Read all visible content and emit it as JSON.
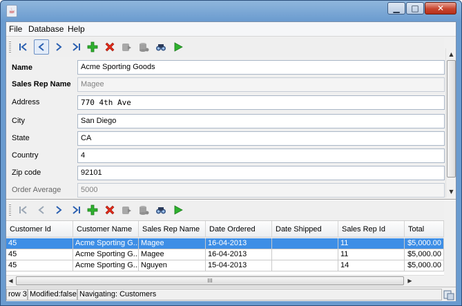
{
  "window": {
    "title": ""
  },
  "menu": [
    "File",
    "Database",
    "Help"
  ],
  "toolbar_icons": [
    "first-record-icon",
    "previous-record-icon",
    "next-record-icon",
    "last-record-icon",
    "add-record-icon",
    "delete-record-icon",
    "save-record-icon",
    "revert-record-icon",
    "find-icon",
    "run-icon"
  ],
  "form": {
    "name_label": "Name",
    "name_value": "Acme Sporting Goods",
    "salesrep_label": "Sales Rep Name",
    "salesrep_value": "Magee",
    "address_label": "Address",
    "address_value": "770 4th Ave",
    "city_label": "City",
    "city_value": "San Diego",
    "state_label": "State",
    "state_value": "CA",
    "country_label": "Country",
    "country_value": "4",
    "zip_label": "Zip code",
    "zip_value": "92101",
    "avg_label": "Order Average",
    "avg_value": "5000"
  },
  "table": {
    "columns": [
      "Customer Id",
      "Customer Name",
      "Sales Rep Name",
      "Date Ordered",
      "Date Shipped",
      "Sales Rep Id",
      "Total"
    ],
    "rows": [
      [
        "45",
        "Acme Sporting G...",
        "Magee",
        "16-04-2013",
        "",
        "11",
        "$5,000.00"
      ],
      [
        "45",
        "Acme Sporting G...",
        "Magee",
        "16-04-2013",
        "",
        "11",
        "$5,000.00"
      ],
      [
        "45",
        "Acme Sporting G...",
        "Nguyen",
        "15-04-2013",
        "",
        "14",
        "$5,000.00"
      ]
    ],
    "selected_row": 0
  },
  "hscroll_grip": "III",
  "status": {
    "row": "row 3",
    "modified": "Modified:false",
    "navigating": "Navigating: Customers"
  },
  "colors": {
    "selection": "#3d8ee6",
    "titlebar": "#6a9bcf"
  }
}
